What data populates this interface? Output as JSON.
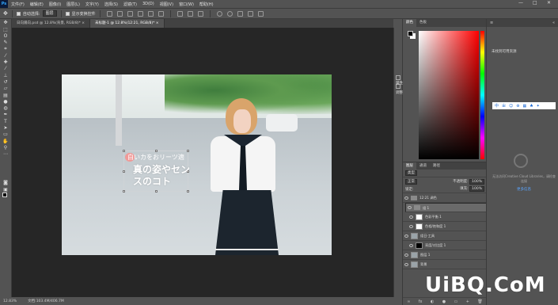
{
  "menu": {
    "logo": "Ps",
    "items": [
      "文件(F)",
      "编辑(E)",
      "图像(I)",
      "图层(L)",
      "文字(Y)",
      "选择(S)",
      "滤镜(T)",
      "3D(D)",
      "视图(V)",
      "窗口(W)",
      "帮助(H)"
    ]
  },
  "window_controls": {
    "minimize": "—",
    "maximize": "□",
    "close": "✕"
  },
  "options": {
    "auto_select_label": "自动选择:",
    "auto_select_value": "图层",
    "show_transform_label": "显示变换控件"
  },
  "tabs": [
    {
      "label": "日向陽向.psd @ 12.8%(背景, RGB/8)*  ×"
    },
    {
      "label": "未标题-1 @ 12.8%(12:21, RGB/8)*  ×"
    }
  ],
  "canvas_text": {
    "line1": "白いカをおリーツ適",
    "line2": "真の姿やセンスのコト"
  },
  "status": {
    "zoom": "12.83%",
    "doc": "文档:103.4M/406.7M"
  },
  "color_panel": {
    "tab_color": "颜色",
    "tab_swatches": "色板"
  },
  "mini_panel": {
    "properties": "属性",
    "adjustments": "调整"
  },
  "layers_panel": {
    "tabs": [
      "图层",
      "通道",
      "路径"
    ],
    "filter": "类型",
    "blend_mode": "正常",
    "opacity_label": "不透明度:",
    "opacity_value": "100%",
    "lock_label": "锁定:",
    "fill_label": "填充:",
    "fill_value": "100%",
    "layers": [
      {
        "name": "12:21 调色",
        "kind": "folder"
      },
      {
        "name": "组 1",
        "kind": "folder",
        "selected": true
      },
      {
        "name": "色彩平衡 1",
        "kind": "white"
      },
      {
        "name": "色相/饱和度 1",
        "kind": "white"
      },
      {
        "name": "组日·工具",
        "kind": "photo"
      },
      {
        "name": "亮度/对比度 1",
        "kind": "black"
      },
      {
        "name": "图层 1",
        "kind": "photo"
      },
      {
        "name": "背景",
        "kind": "photo"
      }
    ],
    "footer_icons": [
      "∞",
      "fx",
      "◐",
      "●",
      "▭",
      "+",
      "🗑"
    ]
  },
  "far_panel": {
    "title": "未找到可用资源",
    "ime": [
      "中",
      "ㄓ",
      "☺",
      "⊕",
      "▦",
      "♣",
      "✦"
    ],
    "cc_text": "无法访问Creative Cloud Libraries，请检查连接",
    "cc_link": "更多信息"
  },
  "watermark": "UiBQ.CoM"
}
